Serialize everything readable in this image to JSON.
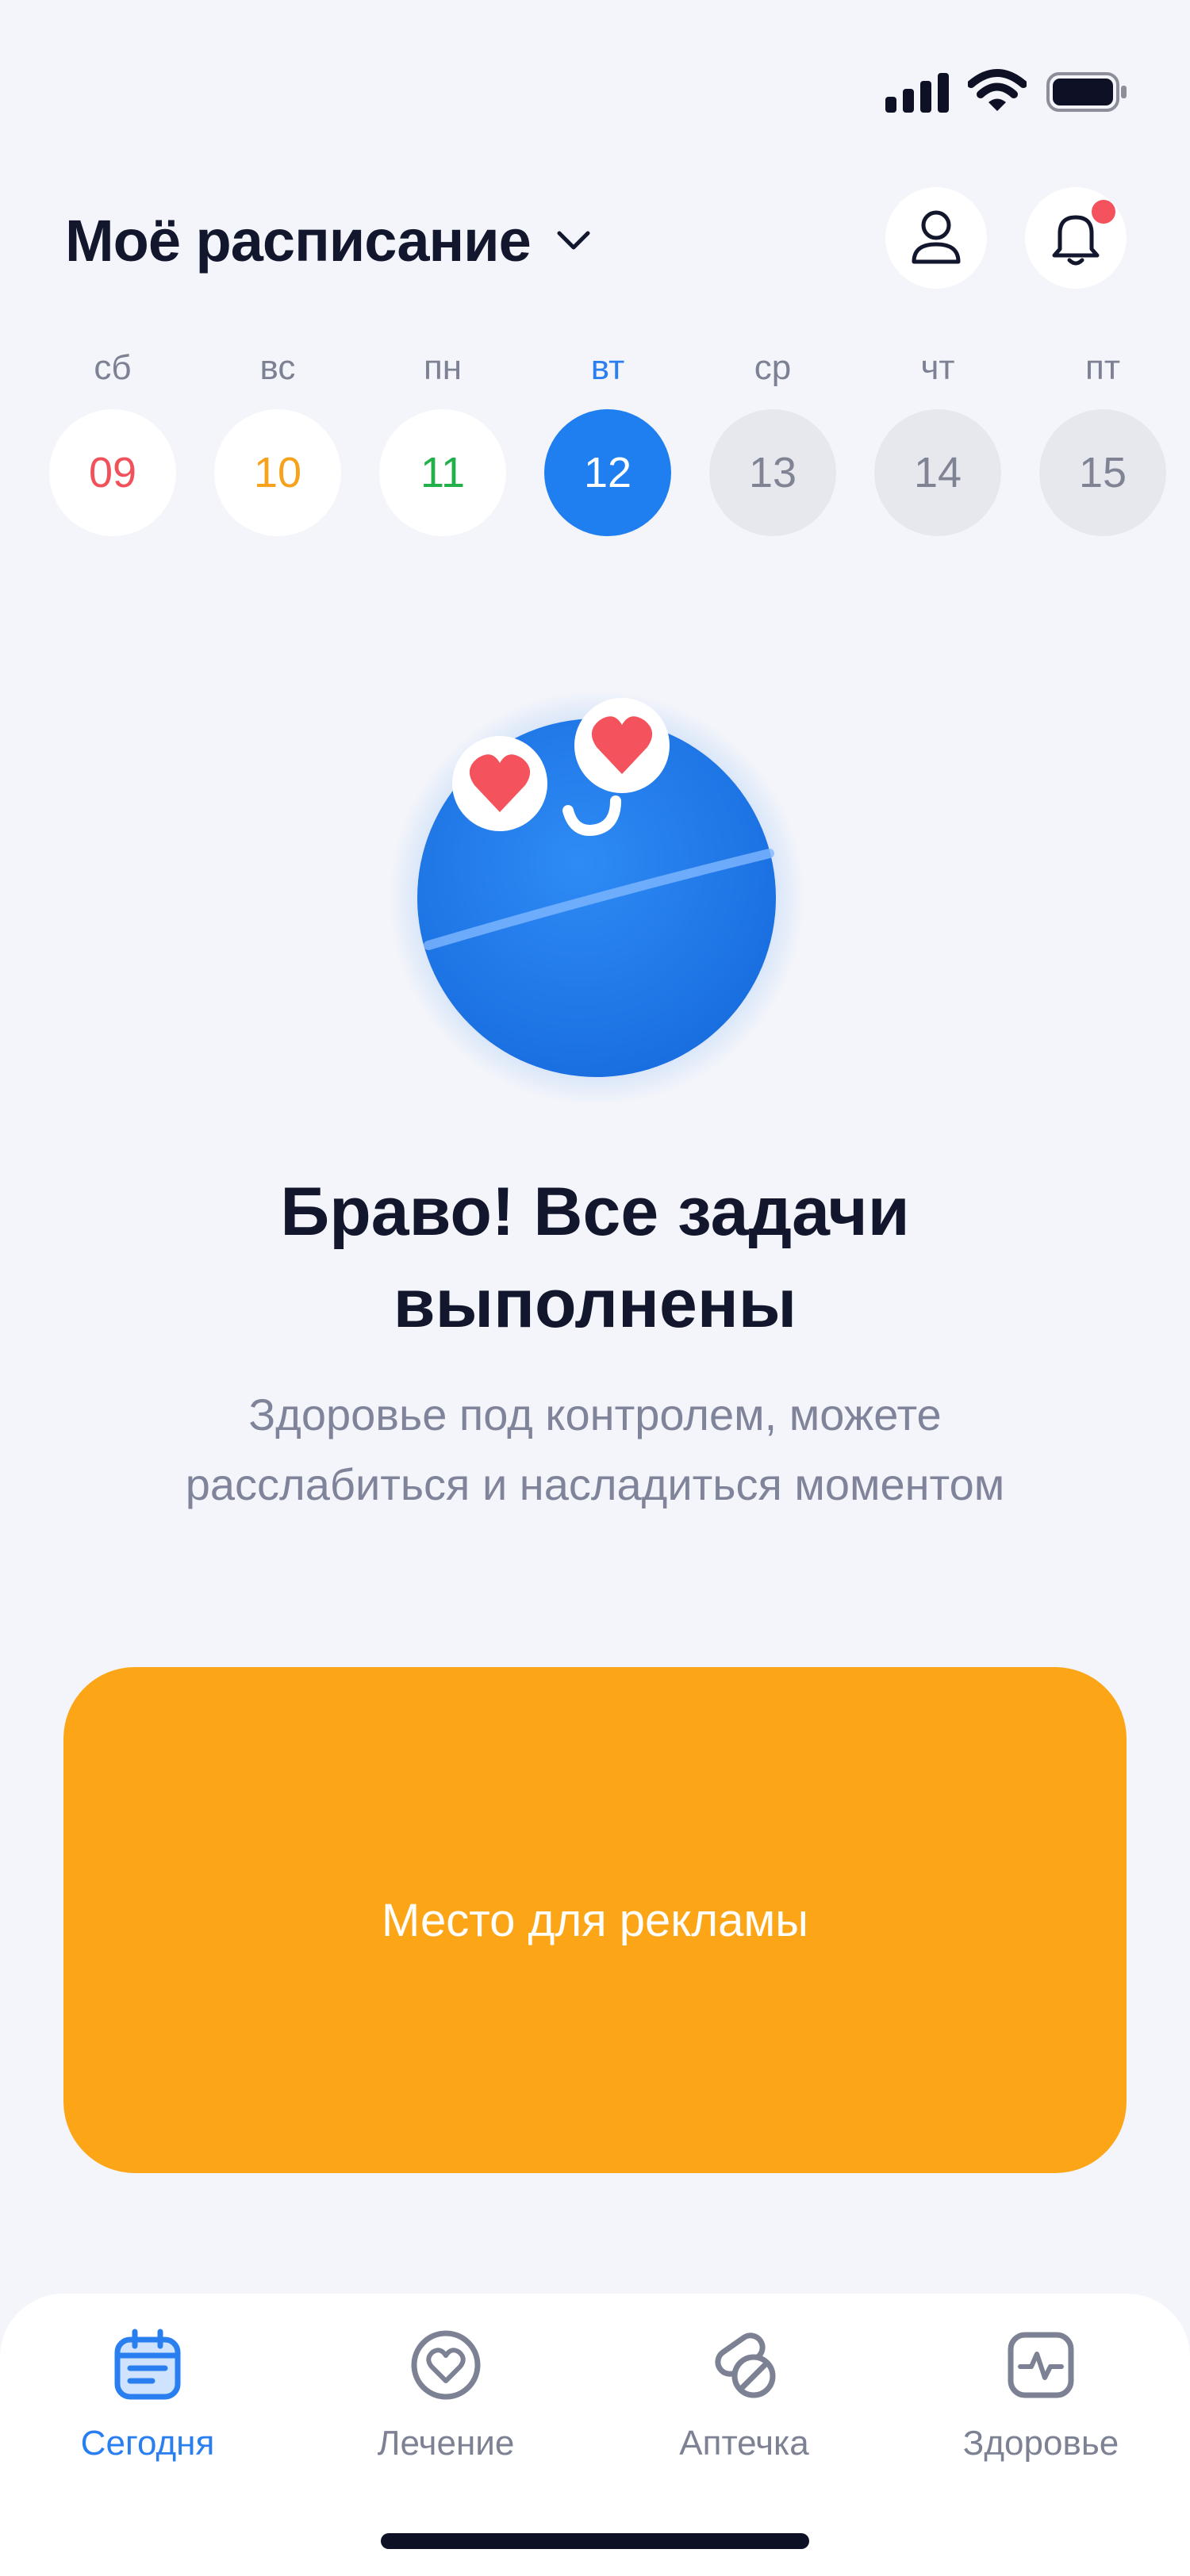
{
  "header": {
    "title": "Моё расписание"
  },
  "week": [
    {
      "label": "сб",
      "day": "09",
      "color": "#f0515a",
      "state": "past"
    },
    {
      "label": "вс",
      "day": "10",
      "color": "#f6a21c",
      "state": "past"
    },
    {
      "label": "пн",
      "day": "11",
      "color": "#22b04b",
      "state": "past"
    },
    {
      "label": "вт",
      "day": "12",
      "color": "#ffffff",
      "state": "today"
    },
    {
      "label": "ср",
      "day": "13",
      "color": "#7f8394",
      "state": "future"
    },
    {
      "label": "чт",
      "day": "14",
      "color": "#7f8394",
      "state": "future"
    },
    {
      "label": "пт",
      "day": "15",
      "color": "#7f8394",
      "state": "future"
    }
  ],
  "main": {
    "title_line1": "Браво! Все задачи",
    "title_line2": "выполнены",
    "subtitle_line1": "Здоровье под контролем, можете",
    "subtitle_line2": "расслабиться и насладиться моментом"
  },
  "ad": {
    "label": "Место для рекламы",
    "color": "#fca617"
  },
  "tabs": [
    {
      "label": "Сегодня",
      "icon": "calendar-icon",
      "active": true
    },
    {
      "label": "Лечение",
      "icon": "heart-icon",
      "active": false
    },
    {
      "label": "Аптечка",
      "icon": "pills-icon",
      "active": false
    },
    {
      "label": "Здоровье",
      "icon": "pulse-icon",
      "active": false
    }
  ],
  "colors": {
    "accent": "#1f7ff0",
    "notification": "#f4525c",
    "background": "#f4f5fa"
  }
}
